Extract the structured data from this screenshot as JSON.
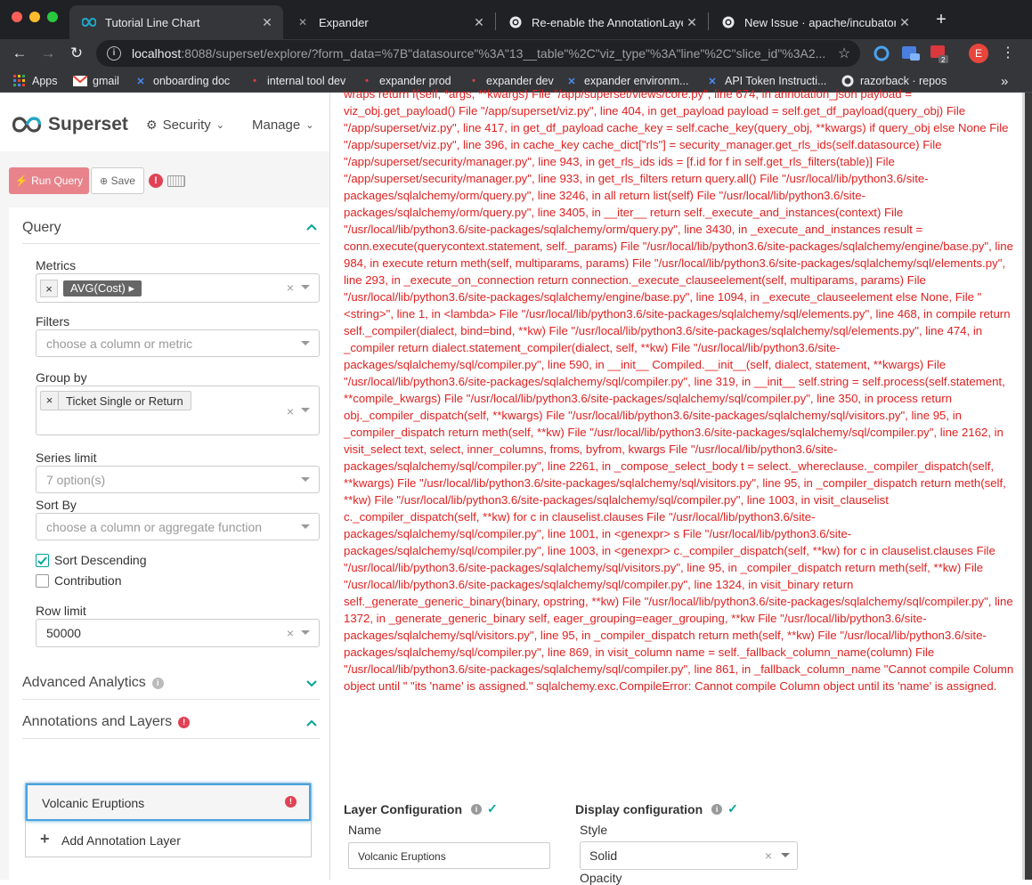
{
  "browser": {
    "tabs": [
      {
        "label": "Tutorial Line Chart",
        "active": true,
        "icon": "superset-icon"
      },
      {
        "label": "Expander",
        "active": false,
        "icon": "expander-icon"
      },
      {
        "label": "Re-enable the AnnotationLayer\\",
        "active": false,
        "icon": "github-icon"
      },
      {
        "label": "New Issue · apache/incubator-su",
        "active": false,
        "icon": "github-icon"
      }
    ],
    "close_glyph": "✕",
    "new_tab_glyph": "+",
    "url_host": "localhost",
    "url_rest": ":8088/superset/explore/?form_data=%7B\"datasource\"%3A\"13__table\"%2C\"viz_type\"%3A\"line\"%2C\"slice_id\"%3A2...",
    "profile_initial": "E",
    "bookmarks": [
      {
        "label": "Apps",
        "icon": "apps-grid-icon"
      },
      {
        "label": "gmail",
        "icon": "gmail-icon"
      },
      {
        "label": "onboarding doc",
        "icon": "confluence-icon"
      },
      {
        "label": "internal tool dev",
        "icon": "pin-icon"
      },
      {
        "label": "expander prod",
        "icon": "pin-icon"
      },
      {
        "label": "expander dev",
        "icon": "pin-icon"
      },
      {
        "label": "expander environm...",
        "icon": "confluence-icon"
      },
      {
        "label": "API Token Instructi...",
        "icon": "confluence-icon"
      },
      {
        "label": "razorback · repos",
        "icon": "github-icon"
      }
    ],
    "bookmarks_more": "»"
  },
  "header": {
    "brand": "Superset",
    "menus": [
      {
        "label": "Security"
      },
      {
        "label": "Manage"
      }
    ]
  },
  "toolbar": {
    "run_label": "Run Query",
    "save_label": "Save"
  },
  "query": {
    "title": "Query",
    "metrics_label": "Metrics",
    "metrics_value": "AVG(Cost)",
    "filters_label": "Filters",
    "filters_placeholder": "choose a column or metric",
    "groupby_label": "Group by",
    "groupby_value": "Ticket Single or Return",
    "series_limit_label": "Series limit",
    "series_limit_placeholder": "7 option(s)",
    "sort_by_label": "Sort By",
    "sort_by_placeholder": "choose a column or aggregate function",
    "sort_desc_label": "Sort Descending",
    "sort_desc_checked": true,
    "contribution_label": "Contribution",
    "contribution_checked": false,
    "row_limit_label": "Row limit",
    "row_limit_value": "50000"
  },
  "advanced": {
    "title": "Advanced Analytics"
  },
  "annotations": {
    "title": "Annotations and Layers",
    "layer_name": "Volcanic Eruptions",
    "add_label": "Add Annotation Layer"
  },
  "modal": {
    "error_text": "wraps return f(self, *args, **kwargs) File \"/app/superset/views/core.py\", line 674, in annotation_json payload = viz_obj.get_payload() File \"/app/superset/viz.py\", line 404, in get_payload payload = self.get_df_payload(query_obj) File \"/app/superset/viz.py\", line 417, in get_df_payload cache_key = self.cache_key(query_obj, **kwargs) if query_obj else None File \"/app/superset/viz.py\", line 396, in cache_key cache_dict[\"rls\"] = security_manager.get_rls_ids(self.datasource) File \"/app/superset/security/manager.py\", line 943, in get_rls_ids ids = [f.id for f in self.get_rls_filters(table)] File \"/app/superset/security/manager.py\", line 933, in get_rls_filters return query.all() File \"/usr/local/lib/python3.6/site-packages/sqlalchemy/orm/query.py\", line 3246, in all return list(self) File \"/usr/local/lib/python3.6/site-packages/sqlalchemy/orm/query.py\", line 3405, in __iter__ return self._execute_and_instances(context) File \"/usr/local/lib/python3.6/site-packages/sqlalchemy/orm/query.py\", line 3430, in _execute_and_instances result = conn.execute(querycontext.statement, self._params) File \"/usr/local/lib/python3.6/site-packages/sqlalchemy/engine/base.py\", line 984, in execute return meth(self, multiparams, params) File \"/usr/local/lib/python3.6/site-packages/sqlalchemy/sql/elements.py\", line 293, in _execute_on_connection return connection._execute_clauseelement(self, multiparams, params) File \"/usr/local/lib/python3.6/site-packages/sqlalchemy/engine/base.py\", line 1094, in _execute_clauseelement else None, File \"<string>\", line 1, in <lambda> File \"/usr/local/lib/python3.6/site-packages/sqlalchemy/sql/elements.py\", line 468, in compile return self._compiler(dialect, bind=bind, **kw) File \"/usr/local/lib/python3.6/site-packages/sqlalchemy/sql/elements.py\", line 474, in _compiler return dialect.statement_compiler(dialect, self, **kw) File \"/usr/local/lib/python3.6/site-packages/sqlalchemy/sql/compiler.py\", line 590, in __init__ Compiled.__init__(self, dialect, statement, **kwargs) File \"/usr/local/lib/python3.6/site-packages/sqlalchemy/sql/compiler.py\", line 319, in __init__ self.string = self.process(self.statement, **compile_kwargs) File \"/usr/local/lib/python3.6/site-packages/sqlalchemy/sql/compiler.py\", line 350, in process return obj._compiler_dispatch(self, **kwargs) File \"/usr/local/lib/python3.6/site-packages/sqlalchemy/sql/visitors.py\", line 95, in _compiler_dispatch return meth(self, **kw) File \"/usr/local/lib/python3.6/site-packages/sqlalchemy/sql/compiler.py\", line 2162, in visit_select text, select, inner_columns, froms, byfrom, kwargs File \"/usr/local/lib/python3.6/site-packages/sqlalchemy/sql/compiler.py\", line 2261, in _compose_select_body t = select._whereclause._compiler_dispatch(self, **kwargs) File \"/usr/local/lib/python3.6/site-packages/sqlalchemy/sql/visitors.py\", line 95, in _compiler_dispatch return meth(self, **kw) File \"/usr/local/lib/python3.6/site-packages/sqlalchemy/sql/compiler.py\", line 1003, in visit_clauselist c._compiler_dispatch(self, **kw) for c in clauselist.clauses File \"/usr/local/lib/python3.6/site-packages/sqlalchemy/sql/compiler.py\", line 1001, in <genexpr> s File \"/usr/local/lib/python3.6/site-packages/sqlalchemy/sql/compiler.py\", line 1003, in <genexpr> c._compiler_dispatch(self, **kw) for c in clauselist.clauses File \"/usr/local/lib/python3.6/site-packages/sqlalchemy/sql/visitors.py\", line 95, in _compiler_dispatch return meth(self, **kw) File \"/usr/local/lib/python3.6/site-packages/sqlalchemy/sql/compiler.py\", line 1324, in visit_binary return self._generate_generic_binary(binary, opstring, **kw) File \"/usr/local/lib/python3.6/site-packages/sqlalchemy/sql/compiler.py\", line 1372, in _generate_generic_binary self, eager_grouping=eager_grouping, **kw File \"/usr/local/lib/python3.6/site-packages/sqlalchemy/sql/visitors.py\", line 95, in _compiler_dispatch return meth(self, **kw) File \"/usr/local/lib/python3.6/site-packages/sqlalchemy/sql/compiler.py\", line 869, in visit_column name = self._fallback_column_name(column) File \"/usr/local/lib/python3.6/site-packages/sqlalchemy/sql/compiler.py\", line 861, in _fallback_column_name \"Cannot compile Column object until \" \"its 'name' is assigned.\" sqlalchemy.exc.CompileError: Cannot compile Column object until its 'name' is assigned.",
    "layer_config_title": "Layer Configuration",
    "display_config_title": "Display configuration",
    "name_label": "Name",
    "name_value": "Volcanic Eruptions",
    "style_label": "Style",
    "style_value": "Solid",
    "opacity_label": "Opacity"
  },
  "colors": {
    "accent": "#00a699",
    "error": "#e02020",
    "run_button": "#e8838c",
    "chrome_dark": "#202124"
  }
}
